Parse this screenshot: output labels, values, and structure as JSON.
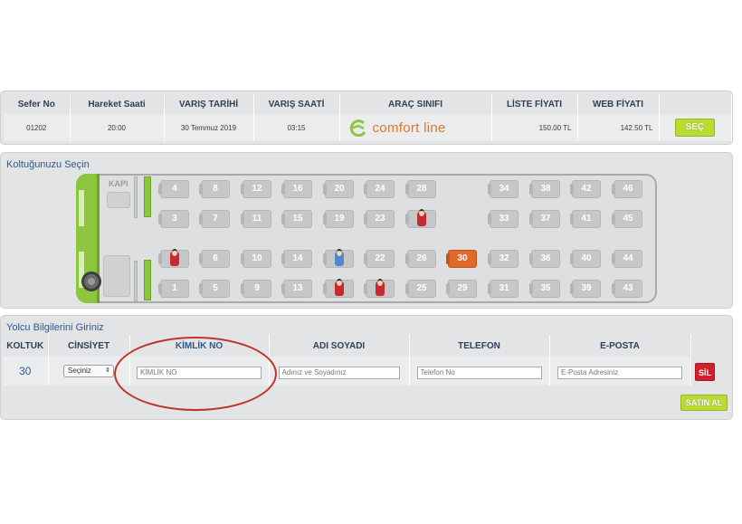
{
  "trip_table": {
    "headers": [
      "Sefer No",
      "Hareket Saati",
      "VARIŞ TARİHİ",
      "VARIŞ SAATİ",
      "ARAÇ SINIFI",
      "LİSTE FİYATI",
      "WEB FİYATI"
    ],
    "row": {
      "sefer_no": "01202",
      "hareket_saati": "20:00",
      "varis_tarihi": "30 Temmuz 2019",
      "varis_saati": "03:15",
      "arac_sinifi": "comfort line",
      "liste_fiyati": "150.00 TL",
      "web_fiyati": "142.50 TL",
      "select_label": "SEÇ"
    }
  },
  "seat_section": {
    "title": "Koltuğunuzu Seçin",
    "door_label": "KAPI",
    "seats": {
      "4": "4",
      "8": "8",
      "12": "12",
      "16": "16",
      "20": "20",
      "24": "24",
      "28": "28",
      "34": "34",
      "38": "38",
      "42": "42",
      "46": "46",
      "3": "3",
      "7": "7",
      "11": "11",
      "15": "15",
      "19": "19",
      "23": "23",
      "33": "33",
      "37": "37",
      "41": "41",
      "45": "45",
      "6": "6",
      "10": "10",
      "14": "14",
      "22": "22",
      "26": "26",
      "30": "30",
      "32": "32",
      "36": "36",
      "40": "40",
      "44": "44",
      "1": "1",
      "5": "5",
      "9": "9",
      "13": "13",
      "25": "25",
      "29": "29",
      "31": "31",
      "35": "35",
      "39": "39",
      "43": "43"
    }
  },
  "passenger_section": {
    "title": "Yolcu Bilgilerini Giriniz",
    "headers": [
      "KOLTUK",
      "CİNSİYET",
      "KİMLİK NO",
      "ADI SOYADI",
      "TELEFON",
      "E-POSTA"
    ],
    "row": {
      "seat": "30",
      "gender_value": "Seçiniz",
      "kimlik_placeholder": "KİMLİK NO",
      "name_placeholder": "Adınız ve Soyadınız",
      "phone_placeholder": "Telefon No",
      "email_placeholder": "E-Posta Adresiniz"
    },
    "delete_label": "SİL",
    "buy_label": "SATIN AL"
  },
  "colors": {
    "accent_green": "#b9dc34",
    "selected_seat": "#e06a2c",
    "delete_red": "#d0202c",
    "annotation_red": "#c0332a"
  }
}
